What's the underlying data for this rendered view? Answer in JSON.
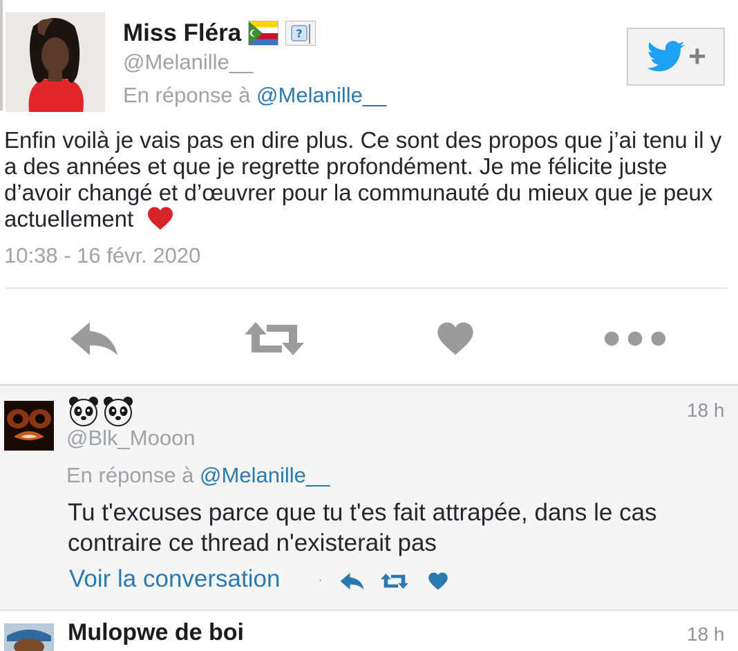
{
  "tweet": {
    "author_name": "Miss Fléra",
    "flag_icons": [
      "comoros-flag-icon",
      "unknown-flag-icon"
    ],
    "flag_unknown_mark": "?",
    "handle": "@Melanille__",
    "reply_prefix": "En réponse à",
    "reply_to": "@Melanille__",
    "text": "Enfin voilà je vais pas en dire plus. Ce sont des propos que j’ai tenu il y a des années et que je regrette profondément. Je me félicite juste d’avoir changé et d’œuvrer pour la communauté du mieux que je peux actuellement",
    "text_end_icon": "red-heart-icon",
    "timestamp": "10:38 - 16 févr. 2020",
    "follow_plus": "+",
    "actions": [
      "reply-icon",
      "retweet-icon",
      "like-icon",
      "more-icon"
    ]
  },
  "replies": [
    {
      "name_icons": [
        "panda-face-icon",
        "panda-face-icon"
      ],
      "handle": "@Blk_Mooon",
      "time": "18 h",
      "reply_prefix": "En réponse à",
      "reply_to": "@Melanille__",
      "text": "Tu t'excuses parce que tu t'es fait attrapée, dans le cas contraire ce thread n'existerait pas",
      "view_conversation": "Voir la conversation",
      "separator": "·",
      "actions": [
        "reply-icon",
        "retweet-icon",
        "like-icon"
      ]
    },
    {
      "name": "Mulopwe de boi",
      "time": "18 h"
    }
  ],
  "colors": {
    "link": "#2a7ab0",
    "twitter_blue": "#1da1f2",
    "muted_text": "#9ea3a8",
    "action_gray": "#9b9b9b",
    "heart_red": "#d8232a",
    "reply_bg": "#f5f5f5"
  }
}
